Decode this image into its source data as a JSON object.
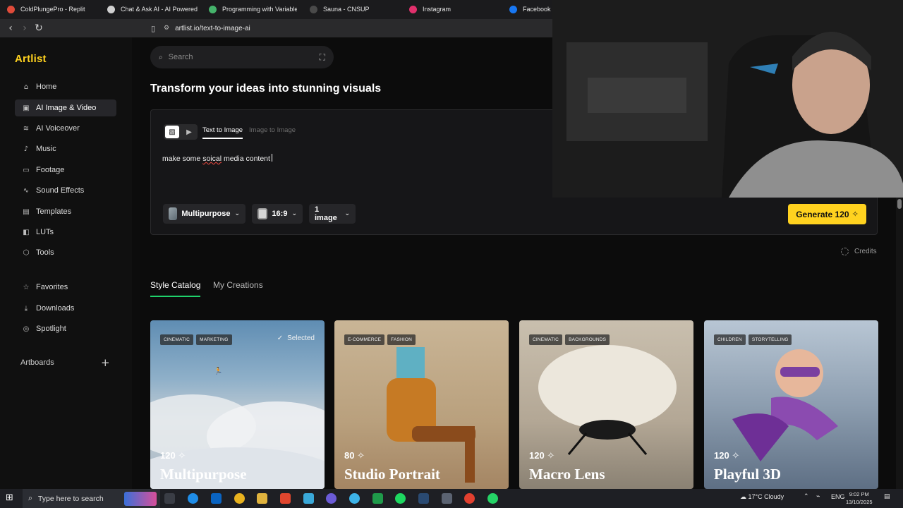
{
  "browser": {
    "tabs": [
      {
        "label": "ColdPlungePro - Replit",
        "color": "#e04b3a"
      },
      {
        "label": "Chat & Ask AI - AI Powered Ch",
        "color": "#d0d0d0"
      },
      {
        "label": "Programming with Variables | E",
        "color": "#45b36b"
      },
      {
        "label": "Sauna - CNSUP",
        "color": "#4a4a4a"
      },
      {
        "label": "Instagram",
        "color": "#e1306c"
      },
      {
        "label": "Facebook",
        "color": "#1877f2"
      }
    ],
    "url": "artlist.io/text-to-image-ai"
  },
  "sidebar": {
    "logo": "Artlist",
    "items": [
      {
        "label": "Home",
        "icon": "home-icon"
      },
      {
        "label": "AI Image & Video",
        "icon": "ai-image-icon"
      },
      {
        "label": "AI Voiceover",
        "icon": "voiceover-icon"
      },
      {
        "label": "Music",
        "icon": "music-icon"
      },
      {
        "label": "Footage",
        "icon": "footage-icon"
      },
      {
        "label": "Sound Effects",
        "icon": "sound-effects-icon"
      },
      {
        "label": "Templates",
        "icon": "templates-icon"
      },
      {
        "label": "LUTs",
        "icon": "luts-icon"
      },
      {
        "label": "Tools",
        "icon": "tools-icon"
      },
      {
        "label": "Favorites",
        "icon": "star-icon"
      },
      {
        "label": "Downloads",
        "icon": "download-icon"
      },
      {
        "label": "Spotlight",
        "icon": "spotlight-icon"
      }
    ],
    "artboards": "Artboards"
  },
  "search": {
    "placeholder": "Search"
  },
  "page_title": "Transform your ideas into stunning visuals",
  "generator": {
    "tab_active": "Text to Image",
    "tab_inactive": "Image to Image",
    "prompt_before": "make some ",
    "prompt_typo": "soical",
    "prompt_after": " media content",
    "style": "Multipurpose",
    "ratio": "16:9",
    "count": "1 image",
    "generate_label": "Generate 120",
    "credits_label": "Credits"
  },
  "catalog_tabs": {
    "style_catalog": "Style Catalog",
    "my_creations": "My Creations"
  },
  "cards": [
    {
      "tags": [
        "CINEMATIC",
        "MARKETING"
      ],
      "selected_label": "Selected",
      "cost": "120",
      "name": "Multipurpose"
    },
    {
      "tags": [
        "E-COMMERCE",
        "FASHION"
      ],
      "cost": "80",
      "name": "Studio Portrait"
    },
    {
      "tags": [
        "CINEMATIC",
        "BACKGROUNDS"
      ],
      "cost": "120",
      "name": "Macro Lens"
    },
    {
      "tags": [
        "CHILDREN",
        "STORYTELLING"
      ],
      "cost": "120",
      "name": "Playful 3D"
    }
  ],
  "taskbar": {
    "search_placeholder": "Type here to search",
    "weather": "17°C  Cloudy",
    "lang": "ENG",
    "time": "9:02 PM",
    "date": "13/10/2025"
  },
  "colors": {
    "accent": "#ffd21f",
    "tab_underline": "#1fd26b",
    "background": "#0c0c0c"
  }
}
